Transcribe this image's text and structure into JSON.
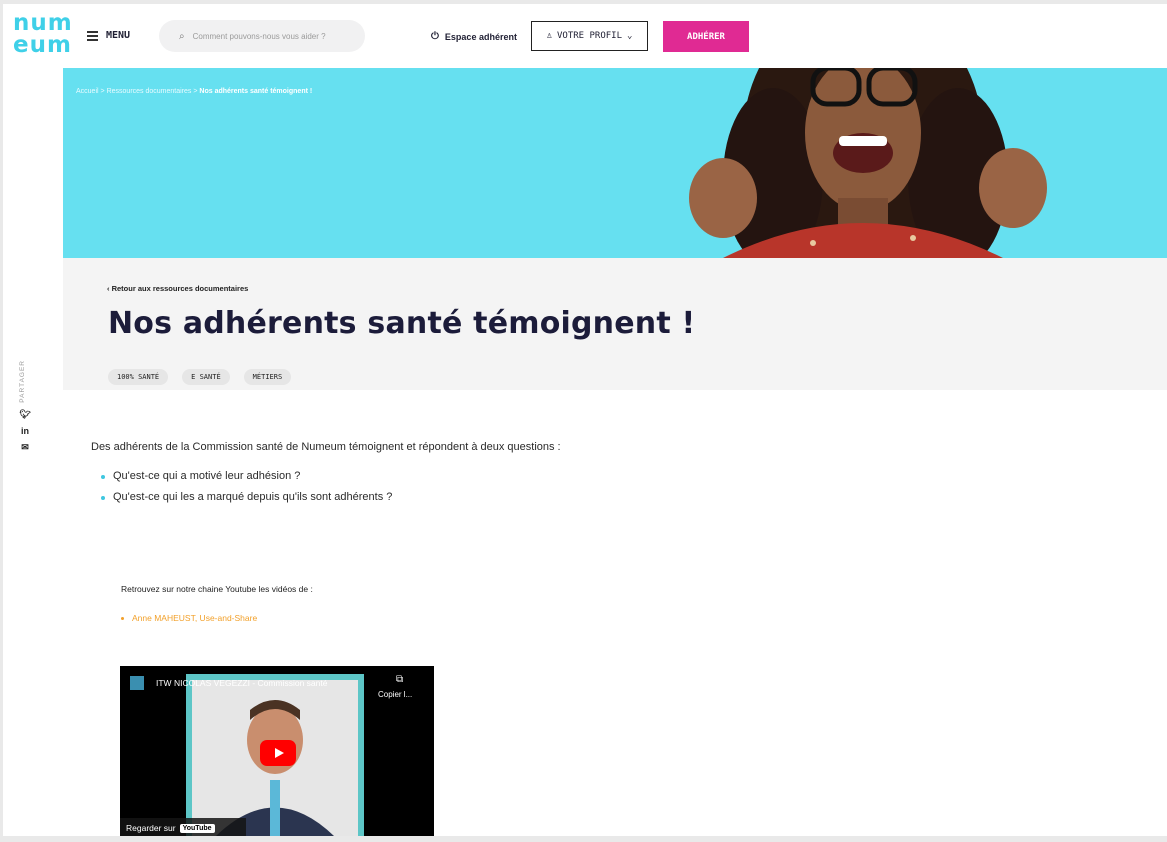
{
  "header": {
    "logo_line1": "num",
    "logo_line2": "eum",
    "menu_label": "MENU",
    "search_placeholder": "Comment pouvons-nous vous aider ?",
    "espace_label": "Espace adhérent",
    "profil_label": "VOTRE PROFIL",
    "adherer_label": "ADHÉRER"
  },
  "breadcrumb": {
    "items": [
      "Accueil",
      "Ressources documentaires",
      "Nos adhérents santé témoignent !"
    ],
    "separator": ">"
  },
  "page": {
    "back_label": "Retour aux ressources documentaires",
    "title": "Nos adhérents santé témoignent !",
    "tags": [
      "100% SANTÉ",
      "E SANTÉ",
      "MÉTIERS"
    ]
  },
  "share": {
    "label": "PARTAGER",
    "icons": [
      "twitter-icon",
      "linkedin-icon",
      "email-icon"
    ]
  },
  "content": {
    "intro": "Des adhérents de la Commission santé de Numeum témoignent et répondent à deux questions :",
    "questions": [
      "Qu'est-ce qui a motivé leur adhésion ?",
      "Qu'est-ce qui les a marqué depuis qu'ils sont adhérents ?"
    ],
    "youtube_intro": "Retrouvez sur notre chaine Youtube les vidéos de :",
    "youtube_items": [
      "Anne MAHEUST, Use-and-Share"
    ]
  },
  "video": {
    "title": "ITW NICOLAS VEGEZZI - Commission santé",
    "copy_label": "Copier l...",
    "watch_label": "Regarder sur",
    "youtube_logo": "YouTube"
  },
  "colors": {
    "brand_cyan": "#66e0f0",
    "accent_pink": "#e02a93",
    "link_orange": "#f2a02a"
  }
}
